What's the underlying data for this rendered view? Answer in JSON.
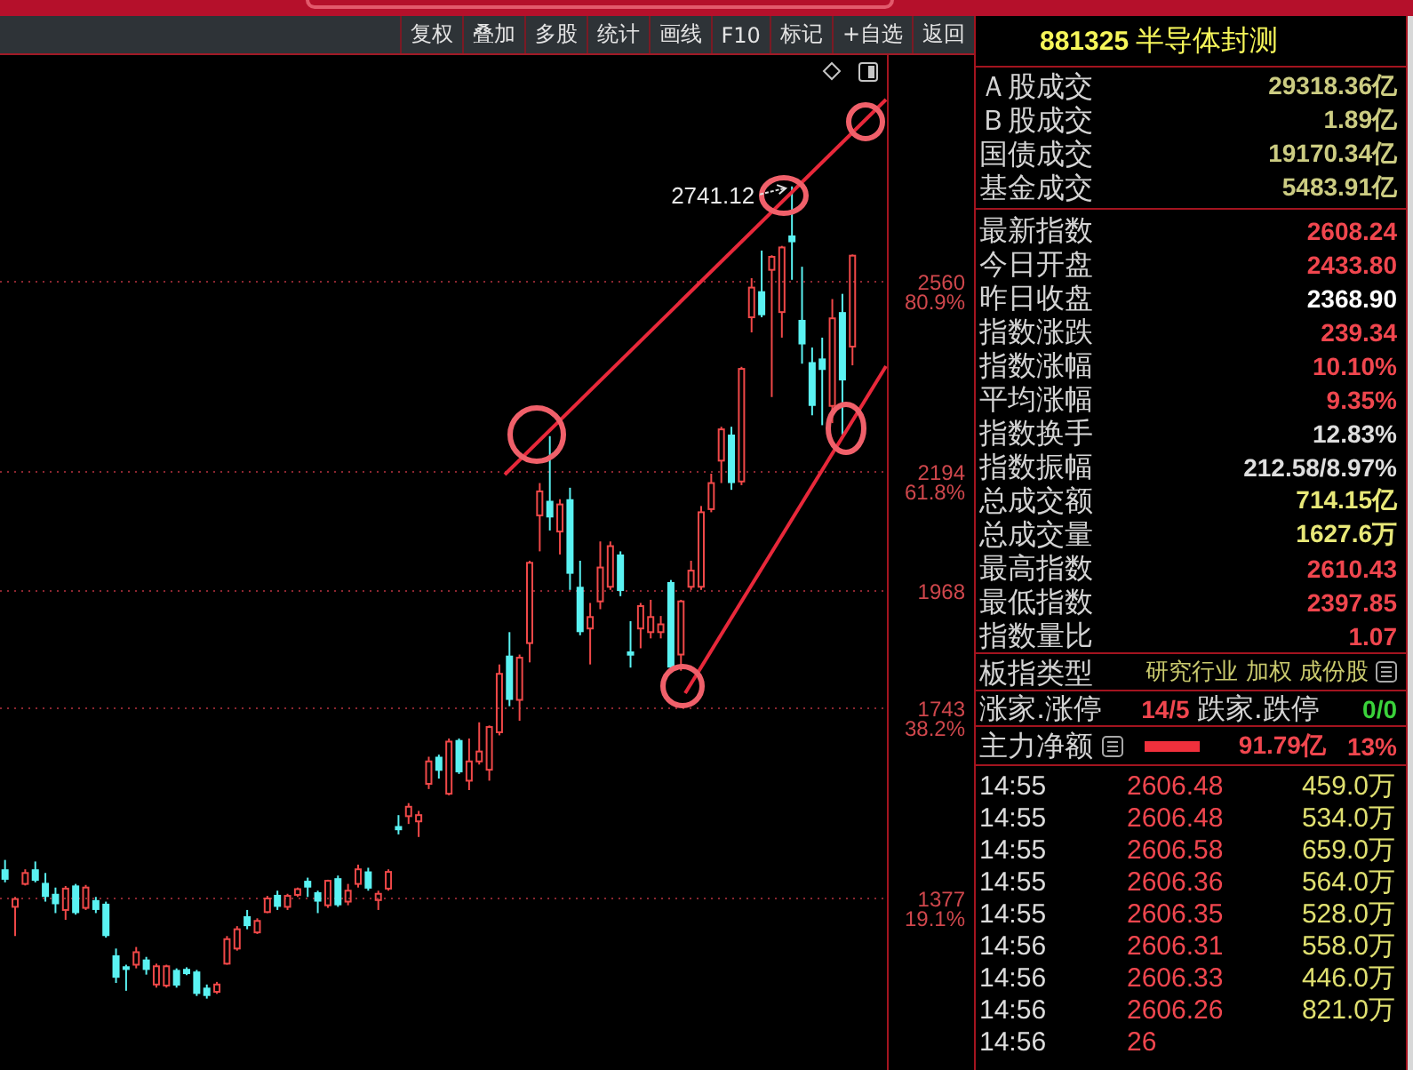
{
  "toolbar": {
    "buttons": [
      "复权",
      "叠加",
      "多股",
      "统计",
      "画线",
      "F10",
      "标记",
      "+自选",
      "返回"
    ]
  },
  "kline_chart": {
    "high_label": "2741.12",
    "percent_labels": [
      "80.9%",
      "61.8%",
      "38.2%",
      "19.1%"
    ],
    "chart_data": {
      "type": "candlestick",
      "grid": true,
      "ylim": [
        1046,
        2993
      ],
      "yticks": [
        2560,
        2194,
        1968,
        1743,
        1377
      ],
      "categories": [
        null,
        null,
        null,
        null,
        null,
        null,
        null,
        null,
        null,
        null,
        null,
        null,
        null,
        null,
        null,
        null,
        null,
        null,
        null,
        null,
        null,
        null,
        null,
        null,
        null,
        null,
        null,
        null,
        null,
        null,
        null,
        null,
        null,
        null,
        null,
        null,
        null,
        null,
        null,
        null,
        null,
        null,
        null,
        null,
        null,
        null,
        null,
        null,
        null,
        null,
        null,
        null,
        null,
        null,
        null,
        null,
        null,
        null,
        null,
        null,
        null,
        null,
        null,
        null,
        null,
        null,
        null,
        null,
        null,
        null,
        null,
        null,
        null,
        null,
        null,
        null,
        null,
        null,
        null,
        null,
        null,
        null,
        null,
        null,
        null,
        null,
        null,
        null
      ],
      "ohlc": [
        [
          1431,
          1449,
          1406,
          1411
        ],
        [
          1359,
          1378,
          1303,
          1374
        ],
        [
          1403,
          1431,
          1400,
          1424
        ],
        [
          1431,
          1446,
          1406,
          1409
        ],
        [
          1405,
          1424,
          1369,
          1378
        ],
        [
          1384,
          1396,
          1347,
          1364
        ],
        [
          1353,
          1399,
          1334,
          1394
        ],
        [
          1400,
          1403,
          1344,
          1347
        ],
        [
          1357,
          1401,
          1353,
          1396
        ],
        [
          1372,
          1378,
          1347,
          1353
        ],
        [
          1365,
          1369,
          1300,
          1303
        ],
        [
          1266,
          1279,
          1213,
          1223
        ],
        [
          1245,
          1248,
          1198,
          1238
        ],
        [
          1248,
          1282,
          1241,
          1272
        ],
        [
          1258,
          1263,
          1229,
          1238
        ],
        [
          1210,
          1250,
          1204,
          1245
        ],
        [
          1208,
          1248,
          1204,
          1245
        ],
        [
          1238,
          1241,
          1204,
          1208
        ],
        [
          1240,
          1243,
          1228,
          1230
        ],
        [
          1235,
          1238,
          1188,
          1192
        ],
        [
          1204,
          1210,
          1183,
          1188
        ],
        [
          1196,
          1215,
          1192,
          1210
        ],
        [
          1250,
          1303,
          1248,
          1297
        ],
        [
          1279,
          1322,
          1275,
          1316
        ],
        [
          1341,
          1353,
          1316,
          1322
        ],
        [
          1310,
          1337,
          1307,
          1332
        ],
        [
          1349,
          1380,
          1347,
          1375
        ],
        [
          1382,
          1390,
          1353,
          1359
        ],
        [
          1359,
          1384,
          1353,
          1380
        ],
        [
          1382,
          1396,
          1378,
          1393
        ],
        [
          1409,
          1415,
          1378,
          1396
        ],
        [
          1387,
          1390,
          1347,
          1369
        ],
        [
          1362,
          1411,
          1357,
          1409
        ],
        [
          1414,
          1419,
          1359,
          1362
        ],
        [
          1369,
          1403,
          1362,
          1390
        ],
        [
          1403,
          1440,
          1396,
          1431
        ],
        [
          1427,
          1434,
          1390,
          1394
        ],
        [
          1372,
          1390,
          1353,
          1384
        ],
        [
          1394,
          1431,
          1390,
          1426
        ],
        [
          1514,
          1535,
          1498,
          1506
        ],
        [
          1533,
          1558,
          1518,
          1551
        ],
        [
          1523,
          1543,
          1493,
          1535
        ],
        [
          1595,
          1647,
          1585,
          1638
        ],
        [
          1647,
          1651,
          1605,
          1620
        ],
        [
          1576,
          1682,
          1573,
          1676
        ],
        [
          1679,
          1682,
          1614,
          1617
        ],
        [
          1601,
          1682,
          1583,
          1638
        ],
        [
          1638,
          1713,
          1632,
          1657
        ],
        [
          1622,
          1707,
          1601,
          1704
        ],
        [
          1694,
          1824,
          1688,
          1806
        ],
        [
          1841,
          1886,
          1744,
          1756
        ],
        [
          1756,
          1843,
          1716,
          1837
        ],
        [
          1865,
          2023,
          1828,
          2019
        ],
        [
          2110,
          2172,
          2041,
          2156
        ],
        [
          2138,
          2262,
          2081,
          2106
        ],
        [
          2079,
          2141,
          2035,
          2131
        ],
        [
          2141,
          2163,
          1967,
          1998
        ],
        [
          1973,
          2023,
          1880,
          1886
        ],
        [
          1893,
          1942,
          1824,
          1915
        ],
        [
          1945,
          2060,
          1930,
          2010
        ],
        [
          1973,
          2060,
          1967,
          2051
        ],
        [
          2035,
          2041,
          1955,
          1965
        ],
        [
          1849,
          1907,
          1818,
          1841
        ],
        [
          1893,
          1942,
          1855,
          1936
        ],
        [
          1886,
          1948,
          1874,
          1915
        ],
        [
          1886,
          1917,
          1874,
          1901
        ],
        [
          1982,
          1986,
          1812,
          1818
        ],
        [
          1843,
          1948,
          1812,
          1945
        ],
        [
          1973,
          2023,
          1967,
          2004
        ],
        [
          1973,
          2128,
          1967,
          2116
        ],
        [
          2122,
          2190,
          2116,
          2172
        ],
        [
          2215,
          2280,
          2172,
          2275
        ],
        [
          2265,
          2280,
          2159,
          2172
        ],
        [
          2175,
          2395,
          2168,
          2391
        ],
        [
          2490,
          2565,
          2461,
          2547
        ],
        [
          2540,
          2618,
          2490,
          2494
        ],
        [
          2581,
          2609,
          2337,
          2606
        ],
        [
          2500,
          2627,
          2451,
          2624
        ],
        [
          2647,
          2741.12,
          2562,
          2634
        ],
        [
          2485,
          2587,
          2401,
          2438
        ],
        [
          2404,
          2432,
          2302,
          2320
        ],
        [
          2411,
          2451,
          2283,
          2389
        ],
        [
          2320,
          2525,
          2287,
          2488
        ],
        [
          2500,
          2535,
          2265,
          2368.9
        ],
        [
          2433.8,
          2610.43,
          2397.85,
          2608.24
        ],
        null,
        null,
        null
      ]
    }
  },
  "quote_panel": {
    "code": "881325",
    "name": "半导体封测",
    "turnover": [
      {
        "label": "Ａ股成交",
        "value": "29318.36亿"
      },
      {
        "label": "Ｂ股成交",
        "value": "1.89亿"
      },
      {
        "label": "国债成交",
        "value": "19170.34亿"
      },
      {
        "label": "基金成交",
        "value": "5483.91亿"
      }
    ],
    "index_stats": [
      {
        "label": "最新指数",
        "value": "2608.24",
        "color": "#f0464e"
      },
      {
        "label": "今日开盘",
        "value": "2433.80",
        "color": "#f0464e"
      },
      {
        "label": "昨日收盘",
        "value": "2368.90",
        "color": "#ffffff"
      },
      {
        "label": "指数涨跌",
        "value": "239.34",
        "color": "#f0464e"
      },
      {
        "label": "指数涨幅",
        "value": "10.10%",
        "color": "#f0464e"
      },
      {
        "label": "平均涨幅",
        "value": "9.35%",
        "color": "#f0464e"
      },
      {
        "label": "指数换手",
        "value": "12.83%",
        "color": "#dedede"
      },
      {
        "label": "指数振幅",
        "value": "212.58/8.97%",
        "color": "#dedede"
      },
      {
        "label": "总成交额",
        "value": "714.15亿",
        "color": "#e8e878"
      },
      {
        "label": "总成交量",
        "value": "1627.6万",
        "color": "#e8e878"
      },
      {
        "label": "最高指数",
        "value": "2610.43",
        "color": "#f0464e"
      },
      {
        "label": "最低指数",
        "value": "2397.85",
        "color": "#f0464e"
      },
      {
        "label": "指数量比",
        "value": "1.07",
        "color": "#f0464e"
      }
    ],
    "index_type": {
      "label": "板指类型",
      "value": "研究行业 加权 成份股"
    },
    "breadth": {
      "up_label": "涨家.涨停",
      "up_value": "14/5",
      "down_label": "跌家.跌停",
      "down_value": "0/0"
    },
    "main_flow": {
      "label": "主力净额",
      "amount": "91.79亿",
      "ratio": "13%"
    },
    "trades": [
      {
        "time": "14:55",
        "price": "2606.48",
        "volume": "459.0万"
      },
      {
        "time": "14:55",
        "price": "2606.48",
        "volume": "534.0万"
      },
      {
        "time": "14:55",
        "price": "2606.58",
        "volume": "659.0万"
      },
      {
        "time": "14:55",
        "price": "2606.36",
        "volume": "564.0万"
      },
      {
        "time": "14:55",
        "price": "2606.35",
        "volume": "528.0万"
      },
      {
        "time": "14:56",
        "price": "2606.31",
        "volume": "558.0万"
      },
      {
        "time": "14:56",
        "price": "2606.33",
        "volume": "446.0万"
      },
      {
        "time": "14:56",
        "price": "2606.26",
        "volume": "821.0万"
      },
      {
        "time": "14:56",
        "price": "26"
      }
    ]
  }
}
